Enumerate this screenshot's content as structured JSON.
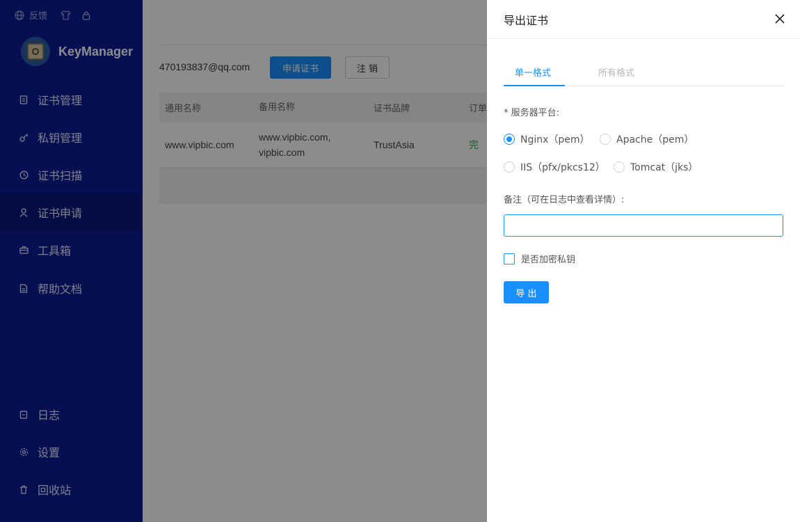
{
  "sidebar": {
    "top_bar": {
      "feedback_label": "反馈"
    },
    "brand": {
      "name": "KeyManager"
    },
    "items": [
      {
        "label": "证书管理",
        "icon": "certificate-icon"
      },
      {
        "label": "私钥管理",
        "icon": "key-icon"
      },
      {
        "label": "证书扫描",
        "icon": "scan-icon"
      },
      {
        "label": "证书申请",
        "icon": "user-icon",
        "active": true
      },
      {
        "label": "工具箱",
        "icon": "toolbox-icon"
      },
      {
        "label": "帮助文档",
        "icon": "document-icon"
      },
      {
        "label": "日志",
        "icon": "log-icon"
      },
      {
        "label": "设置",
        "icon": "gear-icon"
      },
      {
        "label": "回收站",
        "icon": "trash-icon"
      }
    ]
  },
  "main": {
    "account_email": "470193837@qq.com",
    "apply_button": "申请证书",
    "logout_button": "注 销",
    "table": {
      "headers": [
        "通用名称",
        "备用名称",
        "证书品牌",
        "订单"
      ],
      "rows": [
        {
          "common_name": "www.vipbic.com",
          "alt_names": [
            "www.vipbic.com,",
            "vipbic.com"
          ],
          "brand": "TrustAsia",
          "status": "完"
        }
      ]
    }
  },
  "drawer": {
    "title": "导出证书",
    "tabs": [
      {
        "label": "单一格式",
        "active": true
      },
      {
        "label": "所有格式",
        "active": false
      }
    ],
    "platform_label": "* 服务器平台:",
    "platforms": [
      {
        "label": "Nginx（pem）",
        "checked": true
      },
      {
        "label": "Apache（pem）",
        "checked": false
      },
      {
        "label": "IIS（pfx/pkcs12）",
        "checked": false
      },
      {
        "label": "Tomcat（jks）",
        "checked": false
      }
    ],
    "note_label": "备注（可在日志中查看详情）:",
    "note_value": "",
    "encrypt_label": "是否加密私钥",
    "export_button": "导 出"
  },
  "colors": {
    "sidebar_bg": "#0c1c94",
    "primary": "#1890ff",
    "overlay": "rgba(0,0,0,0.45)"
  }
}
